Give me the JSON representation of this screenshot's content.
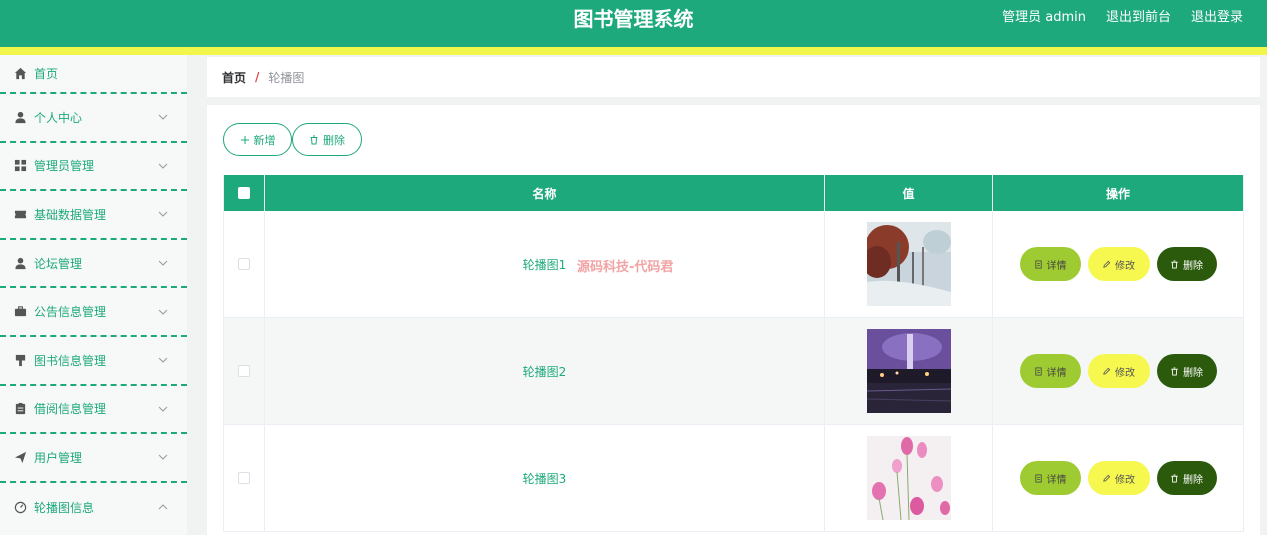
{
  "header": {
    "title": "图书管理系统",
    "user": "管理员 admin",
    "front_link": "退出到前台",
    "logout_link": "退出登录"
  },
  "sidebar": {
    "items": [
      {
        "label": "首页",
        "icon": "home-icon",
        "chevron": ""
      },
      {
        "label": "个人中心",
        "icon": "user-icon",
        "chevron": "down"
      },
      {
        "label": "管理员管理",
        "icon": "grid-icon",
        "chevron": "down"
      },
      {
        "label": "基础数据管理",
        "icon": "ticket-icon",
        "chevron": "down"
      },
      {
        "label": "论坛管理",
        "icon": "user-icon",
        "chevron": "down"
      },
      {
        "label": "公告信息管理",
        "icon": "briefcase-icon",
        "chevron": "down"
      },
      {
        "label": "图书信息管理",
        "icon": "brush-icon",
        "chevron": "down"
      },
      {
        "label": "借阅信息管理",
        "icon": "clipboard-icon",
        "chevron": "down"
      },
      {
        "label": "用户管理",
        "icon": "send-icon",
        "chevron": "down"
      },
      {
        "label": "轮播图信息",
        "icon": "dashboard-icon",
        "chevron": "up"
      }
    ]
  },
  "breadcrumb": {
    "home": "首页",
    "separator": "/",
    "current": "轮播图"
  },
  "toolbar": {
    "add_label": "新增",
    "delete_label": "删除"
  },
  "table": {
    "columns": {
      "name": "名称",
      "value": "值",
      "ops": "操作"
    },
    "rows": [
      {
        "name": "轮播图1",
        "image": "winter-trees-photo"
      },
      {
        "name": "轮播图2",
        "image": "night-lake-photo"
      },
      {
        "name": "轮播图3",
        "image": "pink-flowers-photo"
      }
    ],
    "op_labels": {
      "detail": "详情",
      "edit": "修改",
      "remove": "删除"
    }
  },
  "watermark": "源码科技-代码君",
  "colors": {
    "primary": "#1ea97c",
    "stripe": "#f3f64a",
    "detail_btn": "#9fcb32",
    "edit_btn": "#f6f74f",
    "remove_btn": "#2b5a0c"
  }
}
